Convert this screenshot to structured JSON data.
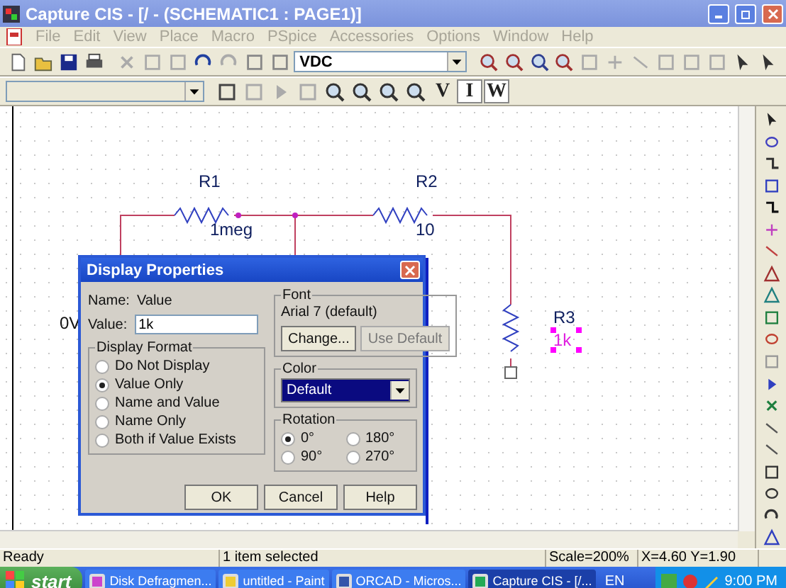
{
  "window": {
    "title": "Capture CIS - [/ - (SCHEMATIC1 : PAGE1)]"
  },
  "menu": [
    "File",
    "Edit",
    "View",
    "Place",
    "Macro",
    "PSpice",
    "Accessories",
    "Options",
    "Window",
    "Help"
  ],
  "toolbar": {
    "part_combo": "VDC",
    "text_buttons": [
      {
        "label": "V",
        "pressed": false
      },
      {
        "label": "I",
        "pressed": true
      },
      {
        "label": "W",
        "pressed": true
      }
    ]
  },
  "schematic": {
    "parts": [
      {
        "ref": "R1",
        "value": "1meg",
        "selected": false
      },
      {
        "ref": "R2",
        "value": "10",
        "selected": false
      },
      {
        "ref": "R3",
        "value": "1k",
        "selected": true
      }
    ],
    "net_label": "0V"
  },
  "dialog": {
    "title": "Display Properties",
    "name_label": "Name:",
    "name_value": "Value",
    "value_label": "Value:",
    "value": "1k",
    "display_format": {
      "title": "Display Format",
      "options": [
        {
          "label": "Do Not Display",
          "selected": false
        },
        {
          "label": "Value Only",
          "selected": true
        },
        {
          "label": "Name and Value",
          "selected": false
        },
        {
          "label": "Name Only",
          "selected": false
        },
        {
          "label": "Both if Value Exists",
          "selected": false
        }
      ]
    },
    "font": {
      "title": "Font",
      "text": "Arial 7 (default)",
      "buttons": [
        {
          "label": "Change...",
          "disabled": false
        },
        {
          "label": "Use Default",
          "disabled": true
        }
      ]
    },
    "color": {
      "title": "Color",
      "value": "Default"
    },
    "rotation": {
      "title": "Rotation",
      "options": [
        {
          "label": "0°",
          "selected": true
        },
        {
          "label": "180°",
          "selected": false
        },
        {
          "label": "90°",
          "selected": false
        },
        {
          "label": "270°",
          "selected": false
        }
      ]
    },
    "buttons": [
      "OK",
      "Cancel",
      "Help"
    ]
  },
  "status_bar": [
    "Ready",
    "1 item selected",
    "Scale=200%",
    "X=4.60  Y=1.90"
  ],
  "taskbar": {
    "start": "start",
    "tasks": [
      {
        "label": "Disk Defragmen...",
        "selected": false
      },
      {
        "label": "untitled - Paint",
        "selected": false
      },
      {
        "label": "ORCAD - Micros...",
        "selected": false
      },
      {
        "label": "Capture CIS - [/...",
        "selected": true
      }
    ],
    "language": "EN",
    "clock": "9:00 PM"
  }
}
